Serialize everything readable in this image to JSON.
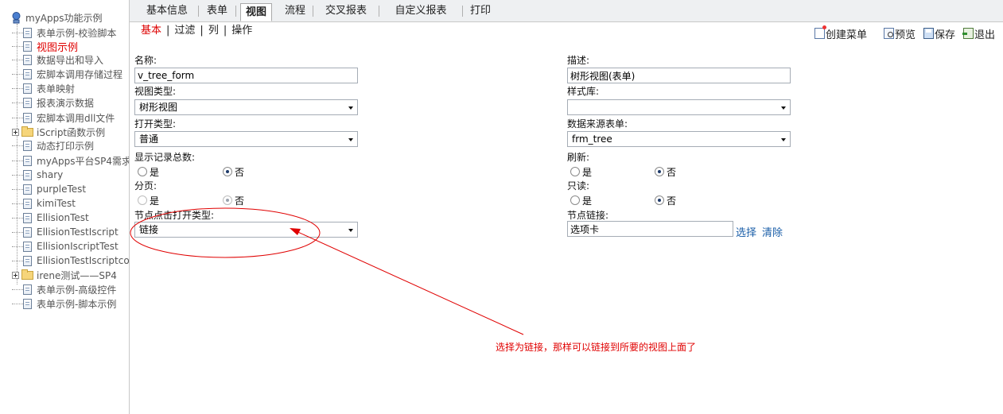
{
  "sidebar": {
    "root_label": "myApps功能示例",
    "items": [
      {
        "label": "表单示例-校验脚本",
        "type": "doc"
      },
      {
        "label": "视图示例",
        "type": "doc",
        "active": true
      },
      {
        "label": "数据导出和导入",
        "type": "doc"
      },
      {
        "label": "宏脚本调用存储过程",
        "type": "doc"
      },
      {
        "label": "表单映射",
        "type": "doc"
      },
      {
        "label": "报表演示数据",
        "type": "doc"
      },
      {
        "label": "宏脚本调用dll文件",
        "type": "doc"
      },
      {
        "label": "iScript函数示例",
        "type": "folder"
      },
      {
        "label": "动态打印示例",
        "type": "doc"
      },
      {
        "label": "myApps平台SP4需求",
        "type": "doc"
      },
      {
        "label": "shary",
        "type": "doc"
      },
      {
        "label": "purpleTest",
        "type": "doc"
      },
      {
        "label": "kimiTest",
        "type": "doc"
      },
      {
        "label": "EllisionTest",
        "type": "doc"
      },
      {
        "label": "EllisionTestIscript",
        "type": "doc"
      },
      {
        "label": "EllisionIscriptTest",
        "type": "doc"
      },
      {
        "label": "EllisionTestIscriptco",
        "type": "doc"
      },
      {
        "label": "irene测试——SP4",
        "type": "folder"
      },
      {
        "label": "表单示例-高级控件",
        "type": "doc"
      },
      {
        "label": "表单示例-脚本示例",
        "type": "doc"
      }
    ]
  },
  "tabs": [
    "基本信息",
    "表单",
    "视图",
    "流程",
    "交叉报表",
    "自定义报表",
    "打印"
  ],
  "active_tab": "视图",
  "subnav": [
    "基本",
    "过滤",
    "列",
    "操作"
  ],
  "toolbar": {
    "create_menu": "创建菜单",
    "preview": "预览",
    "save": "保存",
    "exit": "退出"
  },
  "form": {
    "name_label": "名称:",
    "name_value": "v_tree_form",
    "desc_label": "描述:",
    "desc_value": "树形视图(表单)",
    "view_type_label": "视图类型:",
    "view_type_value": "树形视图",
    "style_lib_label": "样式库:",
    "style_lib_value": "",
    "open_type_label": "打开类型:",
    "open_type_value": "普通",
    "data_source_label": "数据来源表单:",
    "data_source_value": "frm_tree",
    "show_total_label": "显示记录总数:",
    "refresh_label": "刷新:",
    "paging_label": "分页:",
    "readonly_label": "只读:",
    "yes": "是",
    "no": "否",
    "node_click_label": "节点点击打开类型:",
    "node_click_value": "链接",
    "node_link_label": "节点链接:",
    "node_link_value": "选项卡",
    "select_link": "选择",
    "clear_link": "清除"
  },
  "annotation": {
    "note": "选择为链接，那样可以链接到所要的视图上面了",
    "color": "#e00000"
  }
}
